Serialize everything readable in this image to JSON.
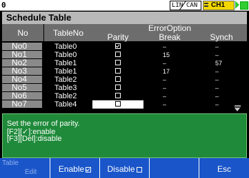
{
  "status": {
    "counter": "0",
    "mode_lin": "LIN",
    "mode_can": "CAN",
    "channel": "CH1"
  },
  "panel": {
    "title": "Schedule Table",
    "col_no": "No",
    "col_tableno": "TableNo",
    "col_erroroption": "ErrorOption",
    "col_parity": "Parity",
    "col_break": "Break",
    "col_synch": "Synch"
  },
  "rows": [
    {
      "no": "No0",
      "table": "Table0",
      "parity_checked": true,
      "break": "–",
      "synch": "–"
    },
    {
      "no": "No1",
      "table": "Table0",
      "parity_checked": false,
      "break": "15",
      "synch": "–"
    },
    {
      "no": "No2",
      "table": "Table1",
      "parity_checked": false,
      "break": "–",
      "synch": "57"
    },
    {
      "no": "No3",
      "table": "Table1",
      "parity_checked": false,
      "break": "17",
      "synch": "–"
    },
    {
      "no": "No4",
      "table": "Table2",
      "parity_checked": false,
      "break": "–",
      "synch": "–"
    },
    {
      "no": "No5",
      "table": "Table3",
      "parity_checked": false,
      "break": "–",
      "synch": "–"
    },
    {
      "no": "No6",
      "table": "Table2",
      "parity_checked": false,
      "break": "–",
      "synch": "–"
    },
    {
      "no": "No7",
      "table": "Table4",
      "parity_checked": false,
      "break": "–",
      "synch": "–"
    }
  ],
  "selected_row": 7,
  "help": {
    "line1": "Set the error of parity.",
    "line2": "[F2][✓]:enable",
    "line3": "[F3][Del]:disable"
  },
  "fkeys": {
    "f1_top": "Table",
    "f1_bottom": "Edit",
    "f2": "Enable",
    "f3": "Disable",
    "f4": "",
    "f5": "Esc"
  },
  "colors": {
    "accent_yellow": "#f2d800",
    "help_bg": "#1f8a3a",
    "fkey_bg": "#1a55c9"
  }
}
